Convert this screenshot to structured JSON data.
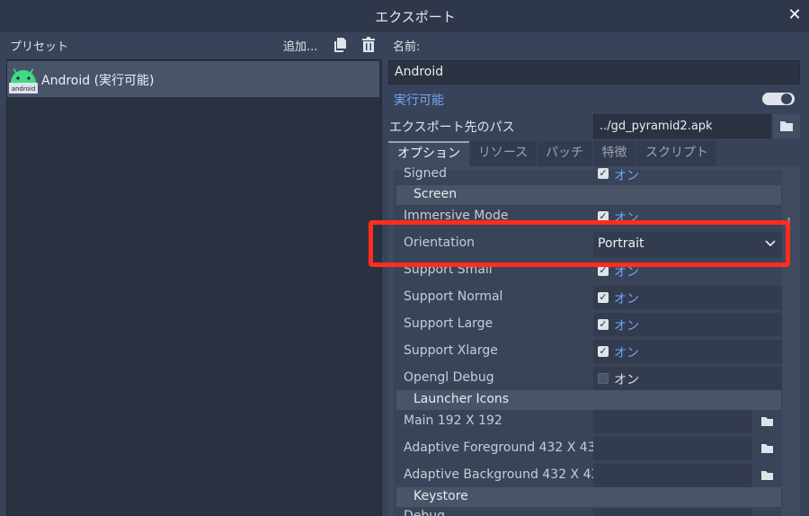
{
  "window": {
    "title": "エクスポート",
    "close": "✕"
  },
  "presets": {
    "label": "プリセット",
    "add_label": "追加...",
    "items": [
      {
        "name": "Android (実行可能)",
        "icon": "android-icon",
        "icon_text": "android"
      }
    ]
  },
  "details": {
    "name_label": "名前:",
    "name_value": "Android",
    "runnable_label": "実行可能",
    "runnable": true,
    "export_path_label": "エクスポート先のパス",
    "export_path_value": "../gd_pyramid2.apk"
  },
  "tabs": [
    {
      "label": "オプション",
      "active": true
    },
    {
      "label": "リソース",
      "active": false
    },
    {
      "label": "パッチ",
      "active": false
    },
    {
      "label": "特徴",
      "active": false
    },
    {
      "label": "スクリプト",
      "active": false
    }
  ],
  "options": {
    "signed": {
      "label": "Signed",
      "value": "オン",
      "checked": true
    },
    "section_screen": "Screen",
    "immersive": {
      "label": "Immersive Mode",
      "value": "オン",
      "checked": true
    },
    "orientation": {
      "label": "Orientation",
      "value": "Portrait"
    },
    "support_small": {
      "label": "Support Small",
      "value": "オン",
      "checked": true
    },
    "support_normal": {
      "label": "Support Normal",
      "value": "オン",
      "checked": true
    },
    "support_large": {
      "label": "Support Large",
      "value": "オン",
      "checked": true
    },
    "support_xlarge": {
      "label": "Support Xlarge",
      "value": "オン",
      "checked": true
    },
    "opengl_debug": {
      "label": "Opengl Debug",
      "value": "オン",
      "checked": false
    },
    "section_launcher": "Launcher Icons",
    "main_192": {
      "label": "Main 192 X 192",
      "value": ""
    },
    "adaptive_fg": {
      "label": "Adaptive Foreground 432 X 43",
      "value": ""
    },
    "adaptive_bg": {
      "label": "Adaptive Background 432 X 43",
      "value": ""
    },
    "section_keystore": "Keystore",
    "debug_partial": {
      "label": "Debug"
    }
  },
  "colors": {
    "accent": "#6fa8f6",
    "highlight": "#ff2d1e",
    "android": "#3ddc84"
  }
}
